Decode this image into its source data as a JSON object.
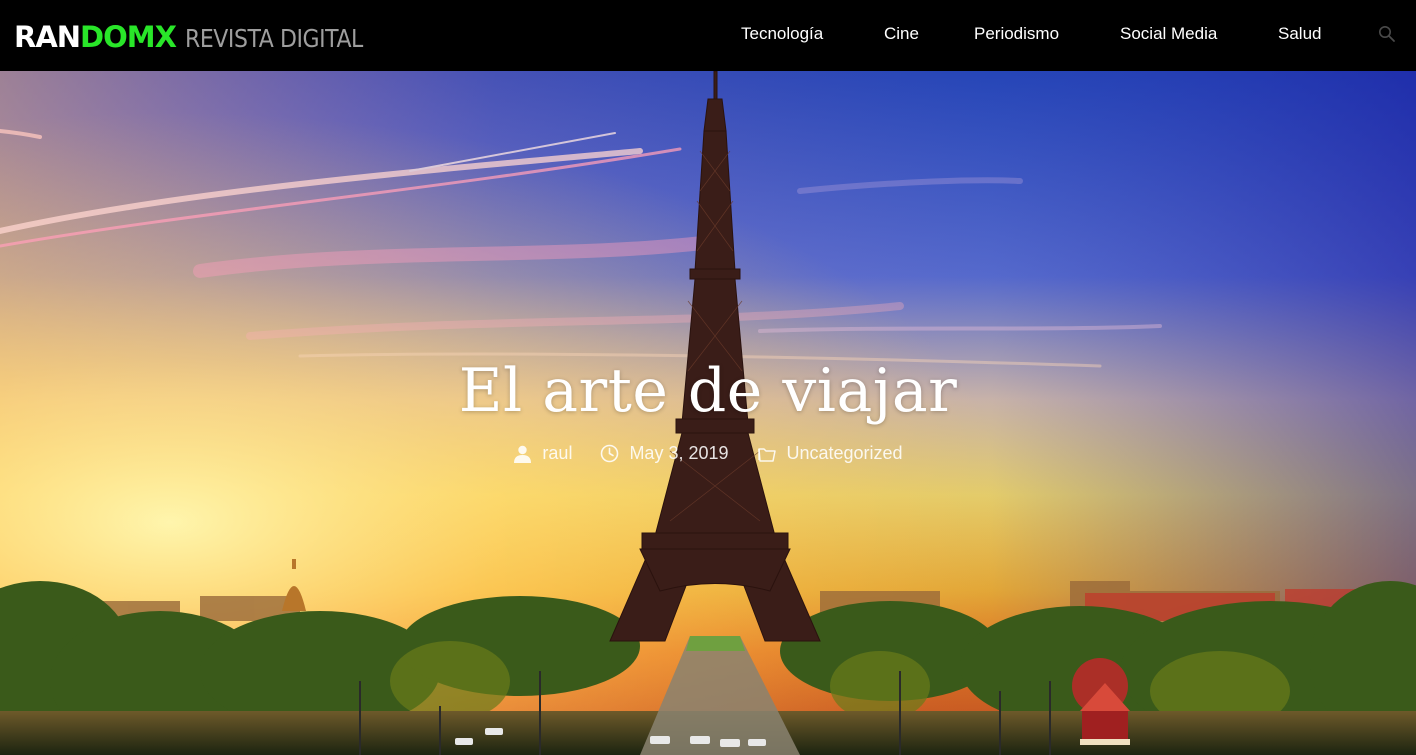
{
  "brand": {
    "part1": "RAN",
    "part2": "DOMX",
    "tagline": "REVISTA DIGITAL",
    "accent": "#29e629"
  },
  "nav": {
    "items": [
      {
        "label": "Tecnología"
      },
      {
        "label": "Cine"
      },
      {
        "label": "Periodismo"
      },
      {
        "label": "Social Media"
      },
      {
        "label": "Salud"
      }
    ],
    "search_icon": "search-icon"
  },
  "hero": {
    "title": "El arte de viajar",
    "author": "raul",
    "date": "May 3, 2019",
    "category": "Uncategorized",
    "icons": {
      "author": "user-icon",
      "date": "clock-icon",
      "category": "folder-icon"
    }
  }
}
